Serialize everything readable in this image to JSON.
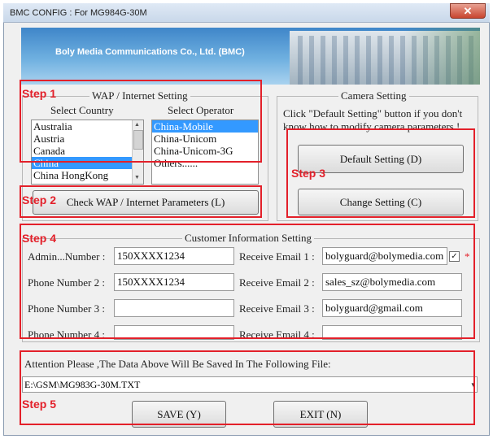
{
  "window": {
    "title": "BMC CONFIG : For MG984G-30M",
    "close_icon": "close-icon"
  },
  "banner": {
    "company": "Boly Media Communications Co., Ltd. (BMC)"
  },
  "wap": {
    "legend": "WAP / Internet Setting",
    "country_header": "Select Country",
    "operator_header": "Select Operator",
    "countries": [
      "Australia",
      "Austria",
      "Canada",
      "China",
      "China HongKong"
    ],
    "selected_country": "China",
    "operators": [
      "China-Mobile",
      "China-Unicom",
      "China-Unicom-3G",
      "Others......"
    ],
    "selected_operator": "China-Mobile",
    "check_button": "Check WAP / Internet Parameters (L)"
  },
  "camera": {
    "legend": "Camera Setting",
    "hint": "Click \"Default Setting\" button if you don't know how to modify camera parameters !",
    "hint_line1": "Click \"Default Setting\" button if you don't",
    "hint_line2": "know how to modify camera parameters !",
    "default_button": "Default Setting (D)",
    "change_button": "Change Setting (C)"
  },
  "customer": {
    "legend": "Customer Information Setting",
    "phones": [
      {
        "label": "Admin...Number :",
        "value": "150XXXX1234"
      },
      {
        "label": "Phone Number 2 :",
        "value": "150XXXX1234"
      },
      {
        "label": "Phone Number 3 :",
        "value": ""
      },
      {
        "label": "Phone Number 4 :",
        "value": ""
      }
    ],
    "emails": [
      {
        "label": "Receive Email 1 :",
        "value": "bolyguard@bolymedia.com"
      },
      {
        "label": "Receive Email 2 :",
        "value": "sales_sz@bolymedia.com"
      },
      {
        "label": "Receive Email 3 :",
        "value": "bolyguard@gmail.com"
      },
      {
        "label": "Receive Email 4 :",
        "value": ""
      }
    ],
    "email1_checked": true,
    "required_mark": "*"
  },
  "file": {
    "attention": "Attention Please ,The Data Above Will Be Saved In The Following  File:",
    "path": "E:\\GSM\\MG983G-30M.TXT"
  },
  "actions": {
    "save": "SAVE (Y)",
    "exit": "EXIT (N)"
  },
  "annotations": {
    "step1": "Step 1",
    "step2": "Step 2",
    "step3": "Step 3",
    "step4": "Step 4",
    "step5": "Step 5",
    "color": "#e3202a"
  }
}
